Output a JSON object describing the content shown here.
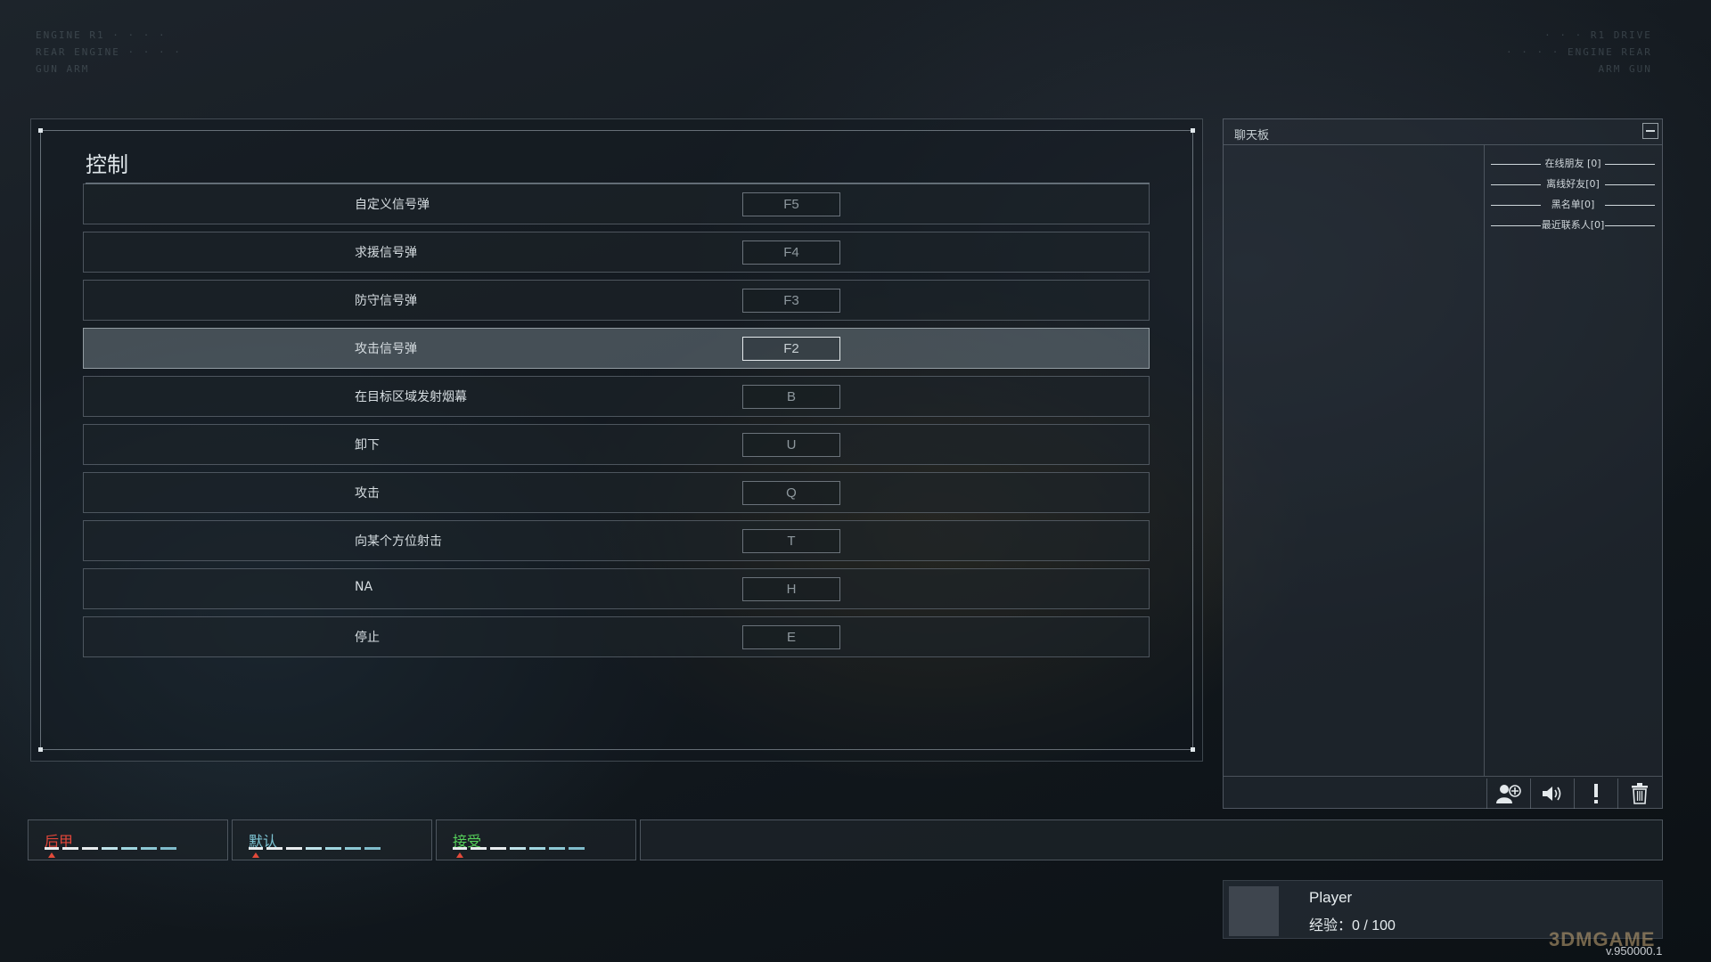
{
  "control": {
    "title": "控制",
    "rows": [
      {
        "label": "自定义信号弹",
        "key": "F5"
      },
      {
        "label": "求援信号弹",
        "key": "F4"
      },
      {
        "label": "防守信号弹",
        "key": "F3"
      },
      {
        "label": "攻击信号弹",
        "key": "F2",
        "selected": true
      },
      {
        "label": "在目标区域发射烟幕",
        "key": "B"
      },
      {
        "label": "卸下",
        "key": "U"
      },
      {
        "label": "攻击",
        "key": "Q"
      },
      {
        "label": "向某个方位射击",
        "key": "T"
      },
      {
        "label": "NA",
        "key": "H"
      },
      {
        "label": "停止",
        "key": "E"
      }
    ]
  },
  "chat": {
    "title": "聊天板",
    "groups": [
      "在线朋友 [0]",
      "离线好友[0]",
      "黑名单[0]",
      "最近联系人[0]"
    ],
    "buttons": [
      "add-friend-icon",
      "speaker-icon",
      "alert-icon",
      "trash-icon"
    ]
  },
  "modes": [
    {
      "label": "后甲",
      "color": "#e2463a"
    },
    {
      "label": "默认",
      "color": "#7fc7d6"
    },
    {
      "label": "接受",
      "color": "#56d15a"
    }
  ],
  "player": {
    "name": "Player",
    "exp_label": "经验：",
    "exp_value": "0 / 100"
  },
  "watermark": "3DMGAME",
  "version": "v.950000.1"
}
